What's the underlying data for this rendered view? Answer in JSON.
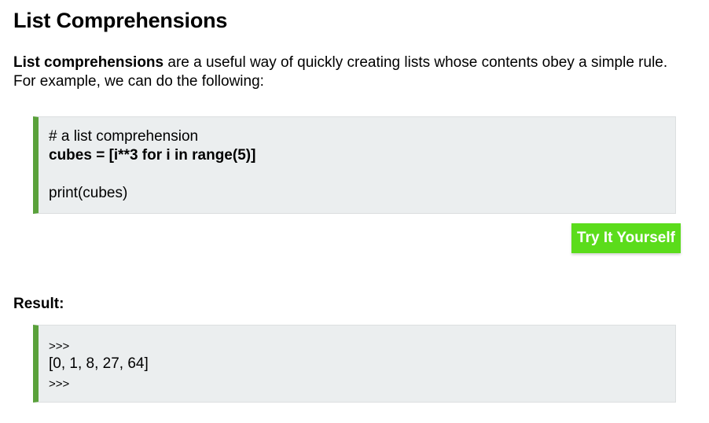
{
  "heading": "List Comprehensions",
  "intro": {
    "bold_text": "List comprehensions",
    "rest_text": " are a useful way of quickly creating lists whose contents obey a simple rule.",
    "line2": "For example, we can do the following:"
  },
  "code": {
    "line1": "# a list comprehension",
    "line2": "cubes = [i**3 for i in range(5)]",
    "line3": "print(cubes)"
  },
  "try_button": {
    "label": "Try It Yourself"
  },
  "result": {
    "label": "Result:",
    "line1": ">>>",
    "line2": "[0, 1, 8, 27, 64]",
    "line3": ">>>"
  },
  "colors": {
    "accent_green": "#5aa13b",
    "button_green": "#5bdc1b",
    "code_bg": "#ebeeef"
  }
}
